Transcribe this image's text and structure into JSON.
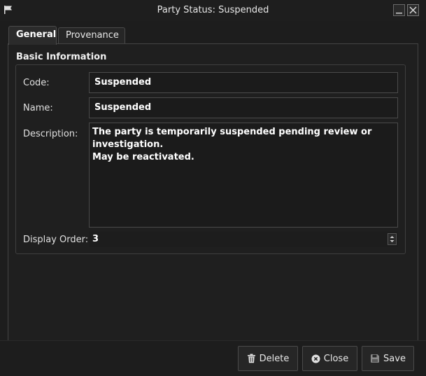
{
  "window": {
    "title": "Party Status: Suspended",
    "icon": "flag-icon"
  },
  "tabs": [
    {
      "label": "General",
      "active": true
    },
    {
      "label": "Provenance",
      "active": false
    }
  ],
  "group": {
    "title": "Basic Information"
  },
  "form": {
    "code_label": "Code:",
    "code_value": "Suspended",
    "name_label": "Name:",
    "name_value": "Suspended",
    "description_label": "Description:",
    "description_value": "The party is temporarily suspended pending review or investigation.\nMay be reactivated.",
    "display_order_label": "Display Order:",
    "display_order_value": "3"
  },
  "buttons": {
    "delete_label": "Delete",
    "close_label": "Close",
    "save_label": "Save"
  },
  "colors": {
    "background": "#1d1d1d",
    "text": "#e6e6e6",
    "border": "#4a4a4a"
  }
}
